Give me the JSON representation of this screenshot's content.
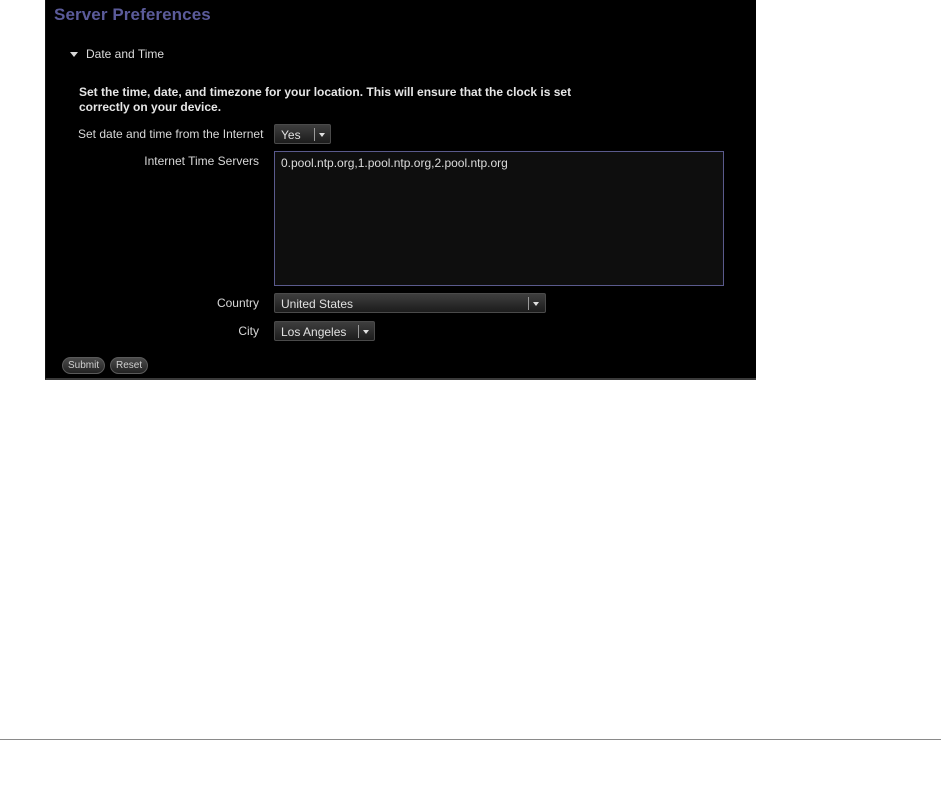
{
  "header": {
    "title": "Server Preferences"
  },
  "section": {
    "label": "Date and Time",
    "expanded": true,
    "description": "Set the time, date, and timezone for your location. This will ensure that the clock is set correctly on your device."
  },
  "form": {
    "internet_time": {
      "label": "Set date and time from the Internet",
      "value": "Yes"
    },
    "time_servers": {
      "label": "Internet Time Servers",
      "value": "0.pool.ntp.org,1.pool.ntp.org,2.pool.ntp.org"
    },
    "country": {
      "label": "Country",
      "value": "United States"
    },
    "city": {
      "label": "City",
      "value": "Los Angeles"
    }
  },
  "actions": {
    "submit_label": "Submit",
    "reset_label": "Reset"
  },
  "colors": {
    "panel_bg": "#000000",
    "title": "#5b5b9a",
    "textarea_border": "#5a5a8c"
  }
}
